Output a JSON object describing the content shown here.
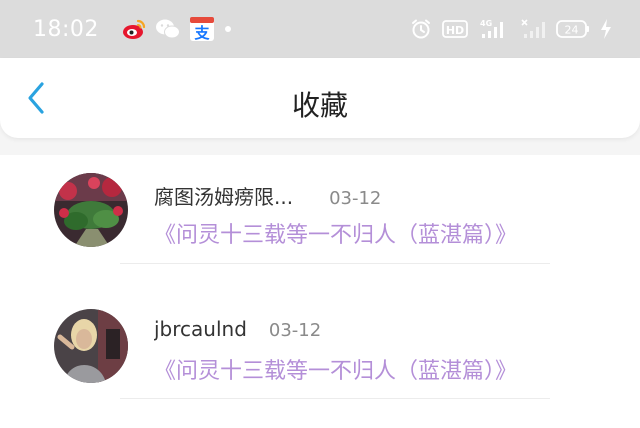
{
  "status_bar": {
    "time": "18:02",
    "hd_label": "HD",
    "network_label": "4G",
    "battery_level": "24",
    "icons": [
      "weibo-icon",
      "wechat-icon",
      "alipay-icon",
      "alarm-icon",
      "hd-icon",
      "signal-4g-icon",
      "signal-icon",
      "battery-icon",
      "charging-icon"
    ]
  },
  "header": {
    "title": "收藏",
    "back_icon": "chevron-left-icon"
  },
  "favorites": [
    {
      "username": "腐图汤姆痨限...",
      "date": "03-12",
      "work_title": "《问灵十三载等一不归人（蓝湛篇）》"
    },
    {
      "username": "jbrcaulnd",
      "date": "03-12",
      "work_title": "《问灵十三载等一不归人（蓝湛篇）》"
    }
  ],
  "colors": {
    "accent_blue": "#2aa3e0",
    "work_title_purple": "#b48fd8",
    "status_bar_bg": "#dcdcdc"
  }
}
